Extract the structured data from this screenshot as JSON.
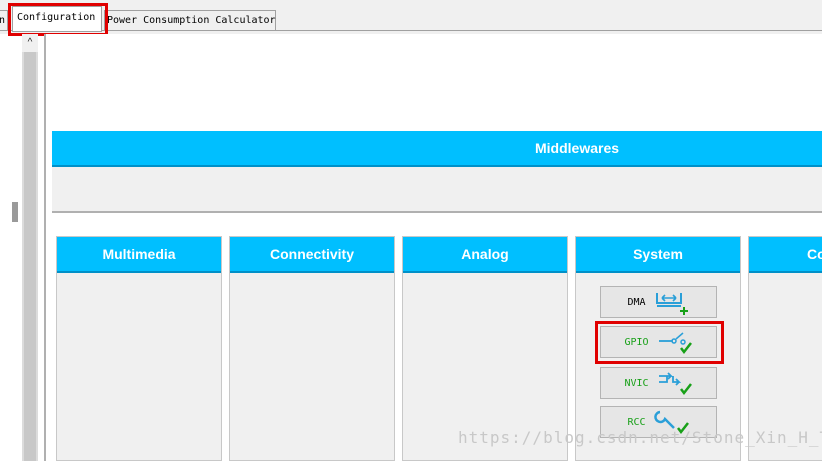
{
  "tabs": {
    "partial_label": "n",
    "active_label": "Configuration",
    "second_label": "Power Consumption Calculator"
  },
  "scrollbar": {
    "up_arrow": "^"
  },
  "middlewares": {
    "title": "Middlewares"
  },
  "categories": [
    {
      "title": "Multimedia"
    },
    {
      "title": "Connectivity"
    },
    {
      "title": "Analog"
    },
    {
      "title": "System"
    },
    {
      "title": "Co"
    }
  ],
  "system_buttons": [
    {
      "label": "DMA",
      "icon": "dma-add-icon",
      "status": "add"
    },
    {
      "label": "GPIO",
      "icon": "gpio-check-icon",
      "status": "ok"
    },
    {
      "label": "NVIC",
      "icon": "nvic-check-icon",
      "status": "ok"
    },
    {
      "label": "RCC",
      "icon": "rcc-wrench-check-icon",
      "status": "ok"
    }
  ],
  "watermark": "https://blog.csdn.net/Stone_Xin_H_T",
  "colors": {
    "header_blue": "#00bfff",
    "highlight_red": "#e00000",
    "ok_green": "#18a018",
    "icon_blue": "#2a9fd8"
  }
}
